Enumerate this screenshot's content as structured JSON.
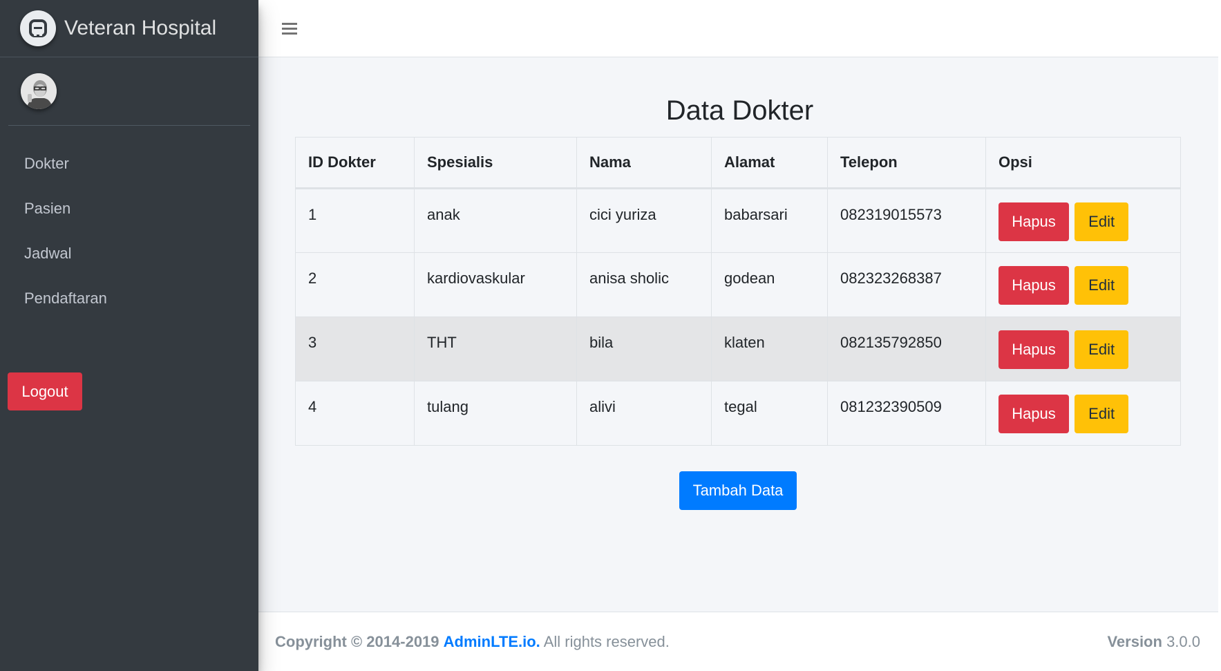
{
  "sidebar": {
    "brand": "Veteran Hospital",
    "nav": [
      {
        "label": "Dokter"
      },
      {
        "label": "Pasien"
      },
      {
        "label": "Jadwal"
      },
      {
        "label": "Pendaftaran"
      }
    ],
    "logout_label": "Logout"
  },
  "main": {
    "title": "Data Dokter",
    "table": {
      "headers": [
        "ID Dokter",
        "Spesialis",
        "Nama",
        "Alamat",
        "Telepon",
        "Opsi"
      ],
      "rows": [
        {
          "id": "1",
          "spesialis": "anak",
          "nama": "cici yuriza",
          "alamat": "babarsari",
          "telepon": "082319015573"
        },
        {
          "id": "2",
          "spesialis": "kardiovaskular",
          "nama": "anisa sholic",
          "alamat": "godean",
          "telepon": "082323268387"
        },
        {
          "id": "3",
          "spesialis": "THT",
          "nama": "bila",
          "alamat": "klaten",
          "telepon": "082135792850"
        },
        {
          "id": "4",
          "spesialis": "tulang",
          "nama": "alivi",
          "alamat": "tegal",
          "telepon": "081232390509"
        }
      ],
      "delete_label": "Hapus",
      "edit_label": "Edit"
    },
    "add_label": "Tambah Data"
  },
  "footer": {
    "copyright": "Copyright © 2014-2019",
    "brand_link": "AdminLTE.io.",
    "rights": "All rights reserved.",
    "version_label": "Version",
    "version": "3.0.0"
  },
  "colors": {
    "sidebar_bg": "#343a40",
    "danger": "#dc3545",
    "warning": "#ffc107",
    "primary": "#007bff",
    "content_bg": "#f4f6f9"
  },
  "icons": {
    "brand": "adminlte-logo-icon",
    "menu": "hamburger-menu-icon"
  }
}
